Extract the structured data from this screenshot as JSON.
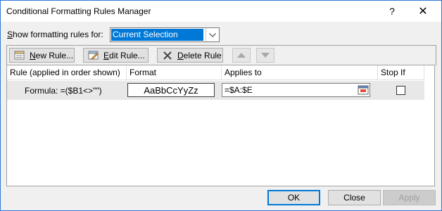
{
  "window": {
    "title": "Conditional Formatting Rules Manager",
    "help_glyph": "?",
    "close_glyph": "✕"
  },
  "show_rules": {
    "label_prefix": "S",
    "label_rest": "how formatting rules for:",
    "selected": "Current Selection"
  },
  "toolbar": {
    "new_key": "N",
    "new_rest": "ew Rule...",
    "edit_key": "E",
    "edit_rest": "dit Rule...",
    "delete_key": "D",
    "delete_rest": "elete Rule"
  },
  "table": {
    "columns": [
      "Rule (applied in order shown)",
      "Format",
      "Applies to",
      "Stop If True"
    ],
    "rows": [
      {
        "rule": "Formula: =($B1<>\"\")",
        "format_preview": "AaBbCcYyZz",
        "applies_to": "=$A:$E",
        "stop_if_true": false
      }
    ]
  },
  "footer": {
    "ok": "OK",
    "close": "Close",
    "apply": "Apply"
  },
  "colors": {
    "accent": "#0078d7",
    "dialog_bg": "#f0f0f0",
    "selected_row": "#e8e8e8"
  }
}
